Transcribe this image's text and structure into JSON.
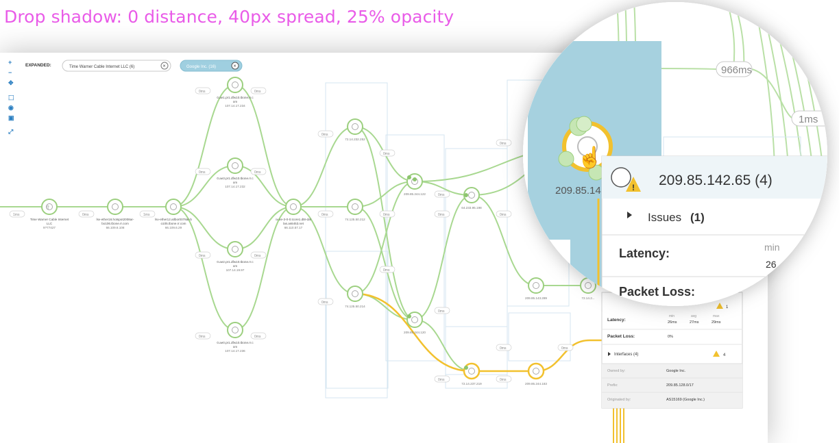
{
  "annotation": "Drop shadow: 0 distance, 40px spread, 25% opacity",
  "toolbar": {
    "expanded_label": "EXPANDED:",
    "filters": [
      {
        "label": "Time Warner Cable Internet LLC (6)",
        "active": false
      },
      {
        "label": "Google Inc. (16)",
        "active": true
      }
    ],
    "tools": [
      "zoom-in-icon",
      "zoom-out-icon",
      "pan-icon",
      "fit-icon",
      "center-icon",
      "image-icon",
      "fullscreen-icon"
    ]
  },
  "nodes": {
    "source": {
      "name": "Time Warner Cable Internet LLC",
      "ip": "9?77427"
    },
    "lsv1": {
      "name": "lsv-ether16.hotspot2008ar-bo106.tbone.rr.com",
      "ip": "66.109.6.108"
    },
    "lsv2": {
      "name": "lsv-ether12.atlbor0078ar-bo105.tbone.rr.com",
      "ip": "66.109.6.29"
    },
    "a1": {
      "name": "0.ae1.pr1.dfw10.tbone.rr.com",
      "ip": "107.14.17.234"
    },
    "a2": {
      "name": "0.ae3.pr1.dfw10.tbone.rr.com",
      "ip": "107.14.17.232"
    },
    "a3": {
      "name": "0.ae2.pr1.dfw10.tbone.rr.com",
      "ip": "107.14.19.97"
    },
    "a4": {
      "name": "0.ae0.pr1.dfw10.tbone.rr.com",
      "ip": "107.14.17.236"
    },
    "conv": {
      "name": "ix-xe-3-0-0.tcore1.dt8-dallas.as6453.net",
      "ip": "66.110.57.17"
    },
    "g1": {
      "ip": "72.14.232.252"
    },
    "g2": {
      "ip": "74.125.50.212"
    },
    "g3": {
      "ip": "74.125.50.214"
    },
    "g4": {
      "ip": "209.85.244.122"
    },
    "g5": {
      "ip": "209.85.244.120"
    },
    "g6": {
      "ip": "64.233.95.198"
    },
    "g7": {
      "ip": "72.14.237.219"
    },
    "g8": {
      "ip": "209.85.244.183"
    },
    "g9": {
      "ip": "209.85.143.289"
    },
    "g10": {
      "ip": "209.85.142.65"
    },
    "g11": {
      "ip": "72.14.2..."
    }
  },
  "latencies": [
    "1ms",
    "0ms",
    "1ms",
    "0ms",
    "0ms",
    "0ms",
    "0ms",
    "0ms",
    "0ms",
    "0ms",
    "0ms",
    "0ms",
    "0ms",
    "0ms",
    "0ms",
    "0ms",
    "0ms",
    "0ms",
    "0ms",
    "0ms",
    "0ms",
    "0ms",
    "0ms",
    "0ms",
    "0ms",
    "0ms",
    "0ms",
    "0ms",
    "0ms",
    "0ms",
    "0ms",
    "0ms",
    "0ms",
    "0ms",
    "0ms",
    "0ms",
    "0ms",
    "0ms",
    "0ms",
    "0ms",
    "0ms",
    "0ms",
    "0ms",
    "0ms",
    "0ms",
    "0ms",
    "0ms",
    "0ms",
    "0ms",
    "0ms",
    "0ms",
    "0ms",
    "0ms",
    "0ms",
    "0ms",
    "0ms",
    "0ms",
    "0ms",
    "0ms",
    "0ms",
    "1ms",
    "0ms",
    "0ms",
    "0ms",
    "0ms",
    "0ms",
    "0ms"
  ],
  "tooltip": {
    "issues_label": "Issues (1)",
    "issues_count": "1",
    "latency_label": "Latency:",
    "latency_cols": [
      "min",
      "avg",
      "max"
    ],
    "latency_vals": [
      "26ms",
      "27ms",
      "29ms"
    ],
    "packet_loss_label": "Packet Loss:",
    "packet_loss_val": "0%",
    "interfaces_label": "Interfaces (4)",
    "interfaces_count": "4",
    "owned_by_label": "Owned by:",
    "owned_by_val": "Google Inc.",
    "prefix_label": "Prefix:",
    "prefix_val": "209.85.128.0/17",
    "originated_label": "Originated by:",
    "originated_val": "AS15169 (Google Inc.)"
  },
  "magnifier": {
    "node_ip": "209.85.142.65 (4)",
    "node_label_partial": "209.85.14",
    "issues_label": "Issues",
    "issues_count": "(1)",
    "latency_label": "Latency:",
    "latency_col": "min",
    "latency_val": "26",
    "packet_loss_label": "Packet Loss:",
    "edge_labels": [
      "966ms",
      "1ms"
    ]
  },
  "colors": {
    "annotation": "#e95be8",
    "edge_green": "#a8d890",
    "edge_yellow": "#f2c12e",
    "node_stroke": "#9ccf7f",
    "hover_blue": "#a6d1df",
    "warning": "#f2c12e"
  }
}
